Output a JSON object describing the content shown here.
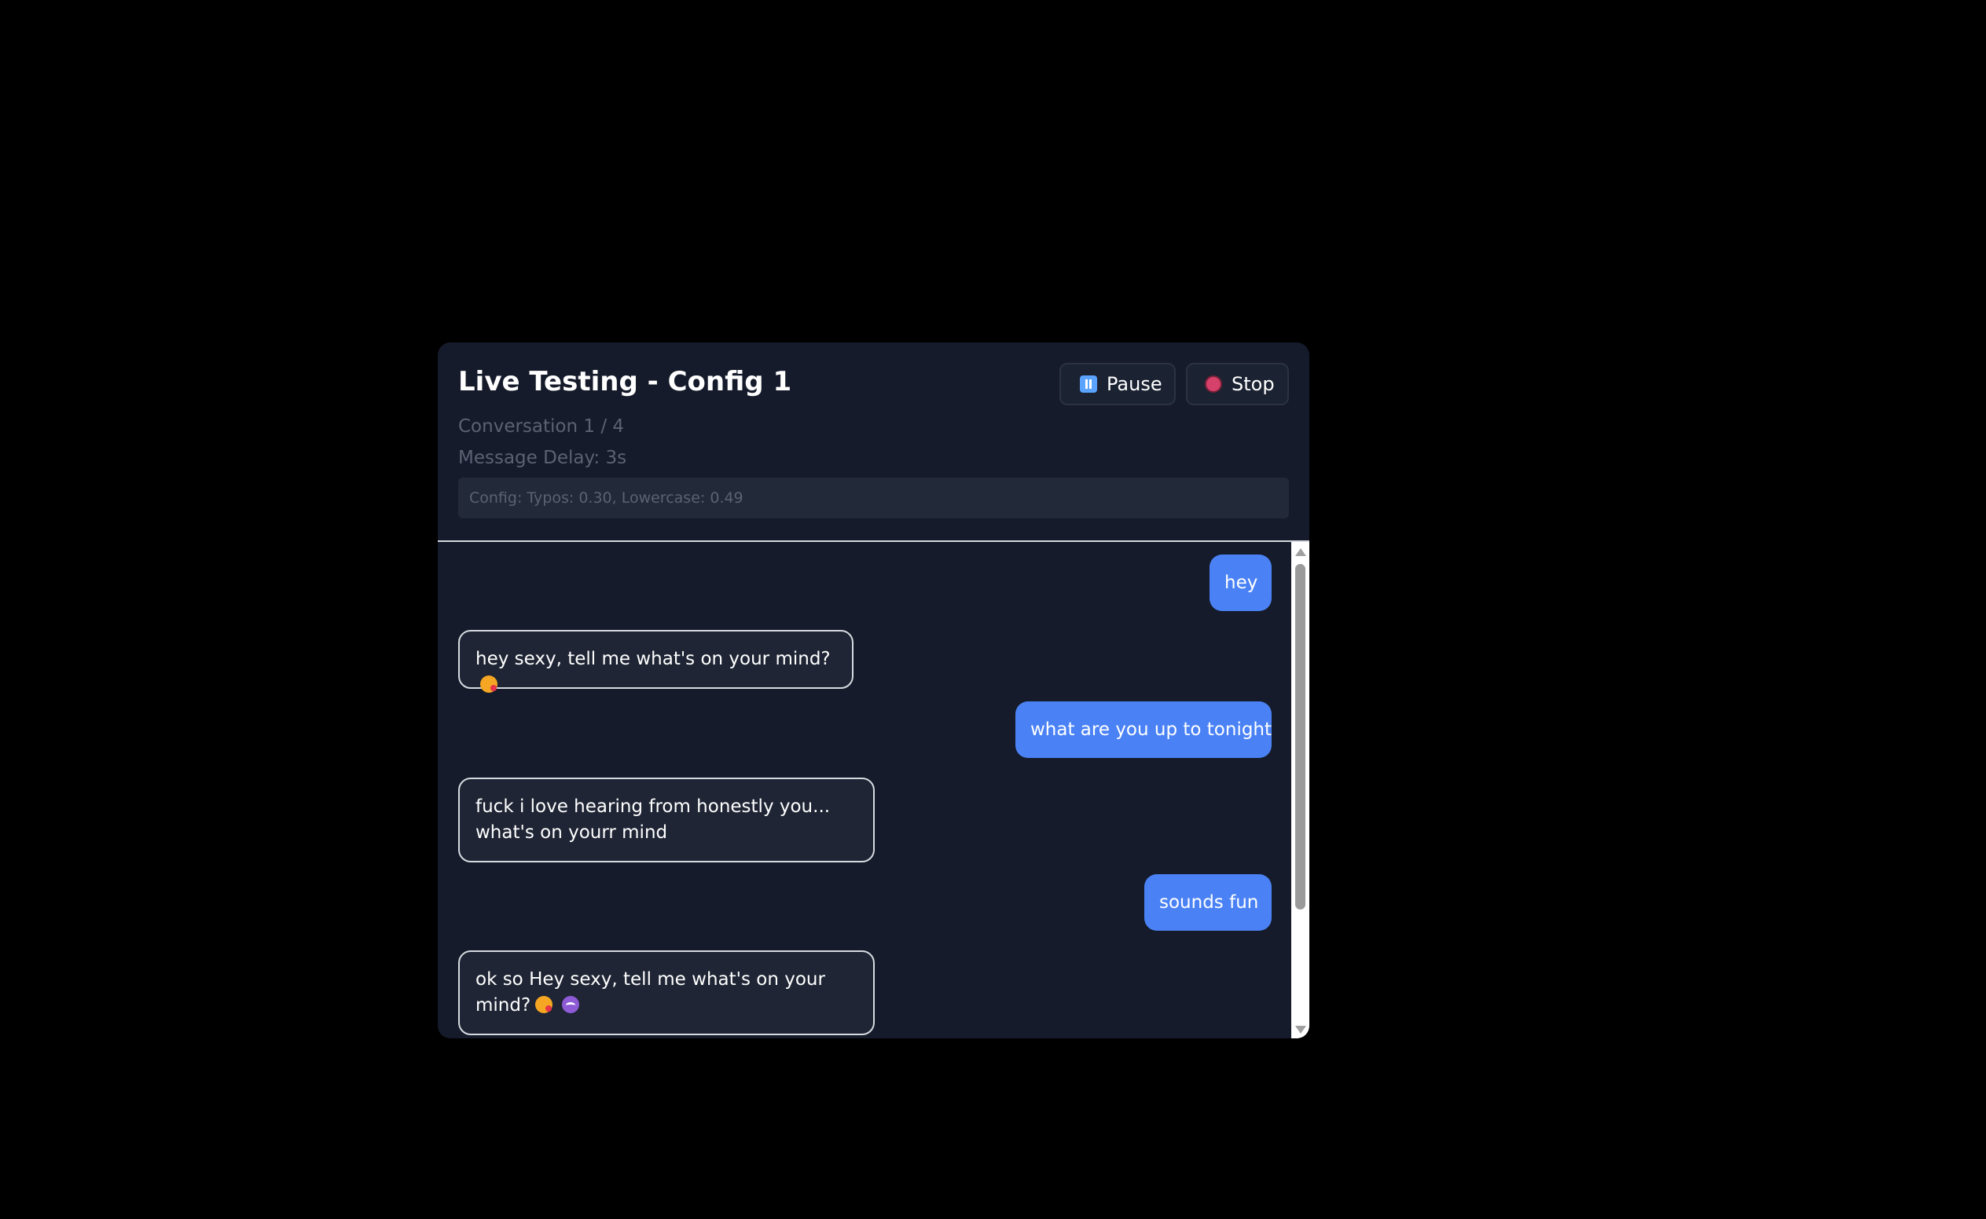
{
  "header": {
    "title": "Live Testing - Config 1",
    "conversation": "Conversation 1 / 4",
    "message_delay": "Message Delay: 3s",
    "config": "Config: Typos: 0.30, Lowercase: 0.49",
    "pause_label": "Pause",
    "stop_label": "Stop",
    "pause_icon": "pause-icon",
    "stop_icon": "stop-circle-icon"
  },
  "messages": [
    {
      "role": "user",
      "text": "hey"
    },
    {
      "role": "bot",
      "text": "hey sexy, tell me what's on your mind?",
      "emoji": [
        "kissing-face"
      ]
    },
    {
      "role": "user",
      "text": "what are you up to tonight"
    },
    {
      "role": "bot",
      "text": "fuck i love hearing from honestly you... what's on yourr mind"
    },
    {
      "role": "user",
      "text": "sounds fun"
    },
    {
      "role": "bot",
      "text": "ok so Hey sexy, tell me what's on your mind?",
      "emoji": [
        "kissing-face",
        "smiling-devil"
      ]
    }
  ],
  "colors": {
    "background": "#000000",
    "panel": "#151b2a",
    "user_bubble": "#4a82f5",
    "bot_bubble": "#1f2534",
    "muted_text": "#5b6273"
  }
}
